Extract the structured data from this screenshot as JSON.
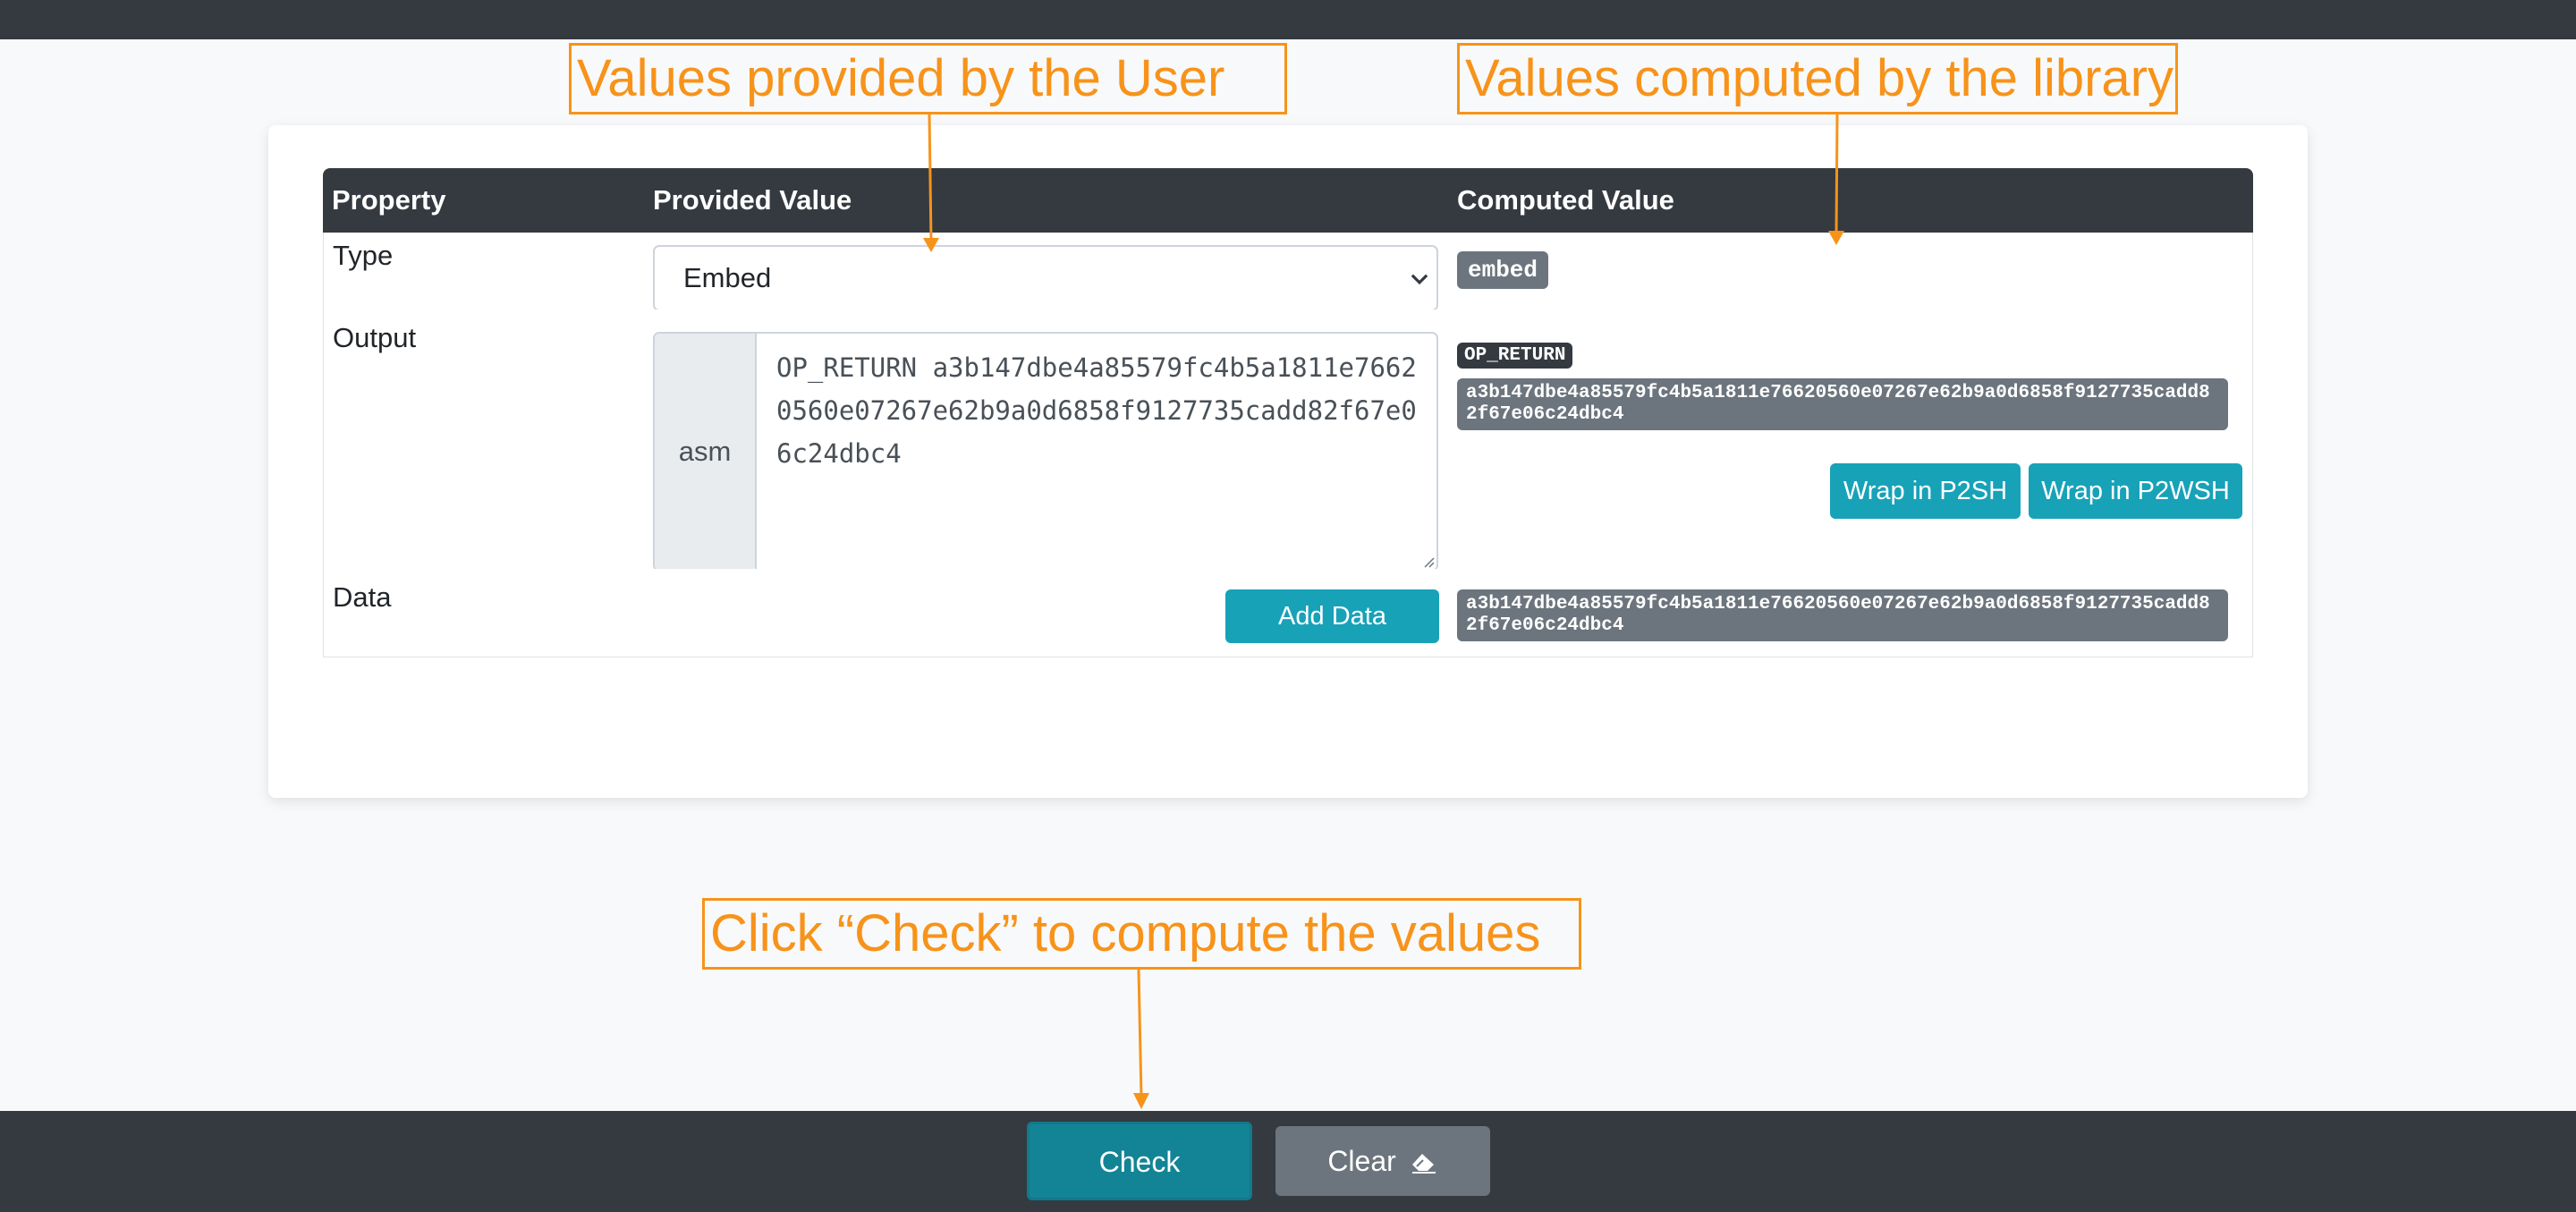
{
  "table": {
    "headers": [
      "Property",
      "Provided Value",
      "Computed Value"
    ],
    "rows": {
      "type": {
        "label": "Type",
        "select_value": "Embed",
        "computed_badge": "embed"
      },
      "output": {
        "label": "Output",
        "prepend": "asm",
        "textarea_value": "OP_RETURN a3b147dbe4a85579fc4b5a1811e76620560e07267e62b9a0d6858f9127735cadd82f67e06c24dbc4",
        "opcode_badge": "OP_RETURN",
        "hex_badge": "a3b147dbe4a85579fc4b5a1811e76620560e07267e62b9a0d6858f9127735cadd82f67e06c24dbc4",
        "wrap_p2sh": "Wrap in P2SH",
        "wrap_p2wsh": "Wrap in P2WSH"
      },
      "data": {
        "label": "Data",
        "add_button": "Add Data",
        "hex_badge": "a3b147dbe4a85579fc4b5a1811e76620560e07267e62b9a0d6858f9127735cadd82f67e06c24dbc4"
      }
    }
  },
  "annotations": {
    "user_values": "Values provided by the User",
    "library_values": "Values computed by the library",
    "check_hint": "Click “Check” to compute the values"
  },
  "footer": {
    "check_label": "Check",
    "clear_label": "Clear"
  },
  "icons": {
    "select_chevron": "chevron-down-icon",
    "clear": "eraser-icon",
    "resize": "resize-handle-icon"
  },
  "colors": {
    "annotation": "#f7931a",
    "header_bg": "#343a40",
    "info_button": "#17a2b8",
    "badge_gray": "#6c757d"
  }
}
